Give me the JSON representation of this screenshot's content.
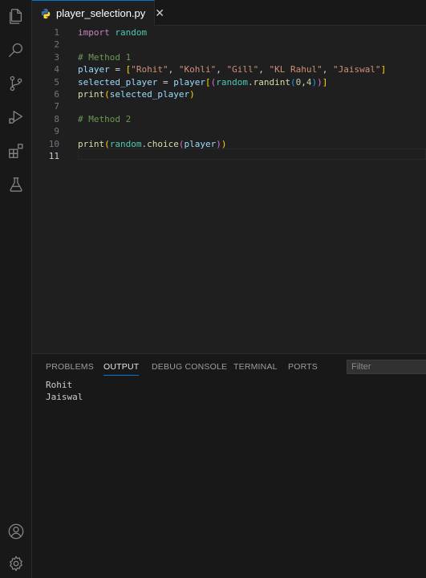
{
  "activity_bar": {
    "icons": [
      "explorer-icon",
      "search-icon",
      "source-control-icon",
      "run-debug-icon",
      "extensions-icon",
      "testing-icon"
    ],
    "bottom_icons": [
      "account-icon",
      "settings-gear-icon"
    ]
  },
  "tab": {
    "filename": "player_selection.py",
    "close": "✕"
  },
  "editor": {
    "current_line": 11,
    "lines": [
      {
        "n": "1",
        "t": [
          [
            "kw",
            "import"
          ],
          [
            "op",
            " "
          ],
          [
            "mod",
            "random"
          ]
        ]
      },
      {
        "n": "2",
        "t": []
      },
      {
        "n": "3",
        "t": [
          [
            "cm",
            "# Method 1"
          ]
        ]
      },
      {
        "n": "4",
        "t": [
          [
            "var",
            "player"
          ],
          [
            "op",
            " = "
          ],
          [
            "b1",
            "["
          ],
          [
            "str",
            "\"Rohit\""
          ],
          [
            "op",
            ", "
          ],
          [
            "str",
            "\"Kohli\""
          ],
          [
            "op",
            ", "
          ],
          [
            "str",
            "\"Gill\""
          ],
          [
            "op",
            ", "
          ],
          [
            "str",
            "\"KL Rahul\""
          ],
          [
            "op",
            ", "
          ],
          [
            "str",
            "\"Jaiswal\""
          ],
          [
            "b1",
            "]"
          ]
        ]
      },
      {
        "n": "5",
        "t": [
          [
            "var",
            "selected_player"
          ],
          [
            "op",
            " = "
          ],
          [
            "var",
            "player"
          ],
          [
            "b1",
            "["
          ],
          [
            "b2",
            "("
          ],
          [
            "mod",
            "random"
          ],
          [
            "op",
            "."
          ],
          [
            "fn",
            "randint"
          ],
          [
            "b3",
            "("
          ],
          [
            "num",
            "0"
          ],
          [
            "op",
            ","
          ],
          [
            "num",
            "4"
          ],
          [
            "b3",
            ")"
          ],
          [
            "b2",
            ")"
          ],
          [
            "b1",
            "]"
          ]
        ]
      },
      {
        "n": "6",
        "t": [
          [
            "fn",
            "print"
          ],
          [
            "b1",
            "("
          ],
          [
            "var",
            "selected_player"
          ],
          [
            "b1",
            ")"
          ]
        ]
      },
      {
        "n": "7",
        "t": []
      },
      {
        "n": "8",
        "t": [
          [
            "cm",
            "# Method 2"
          ]
        ]
      },
      {
        "n": "9",
        "t": []
      },
      {
        "n": "10",
        "t": [
          [
            "fn",
            "print"
          ],
          [
            "b1",
            "("
          ],
          [
            "mod",
            "random"
          ],
          [
            "op",
            "."
          ],
          [
            "fn",
            "choice"
          ],
          [
            "b2",
            "("
          ],
          [
            "var",
            "player"
          ],
          [
            "b2",
            ")"
          ],
          [
            "b1",
            ")"
          ]
        ]
      },
      {
        "n": "11",
        "t": []
      }
    ]
  },
  "panel": {
    "tabs": [
      "PROBLEMS",
      "OUTPUT",
      "DEBUG CONSOLE",
      "TERMINAL",
      "PORTS"
    ],
    "active_tab": "OUTPUT",
    "filter_placeholder": "Filter",
    "output": [
      "Rohit",
      "Jaiswal"
    ]
  },
  "colors": {
    "accent": "#0078d4",
    "editor_bg": "#1f1f1f",
    "sidebar_bg": "#181818"
  }
}
